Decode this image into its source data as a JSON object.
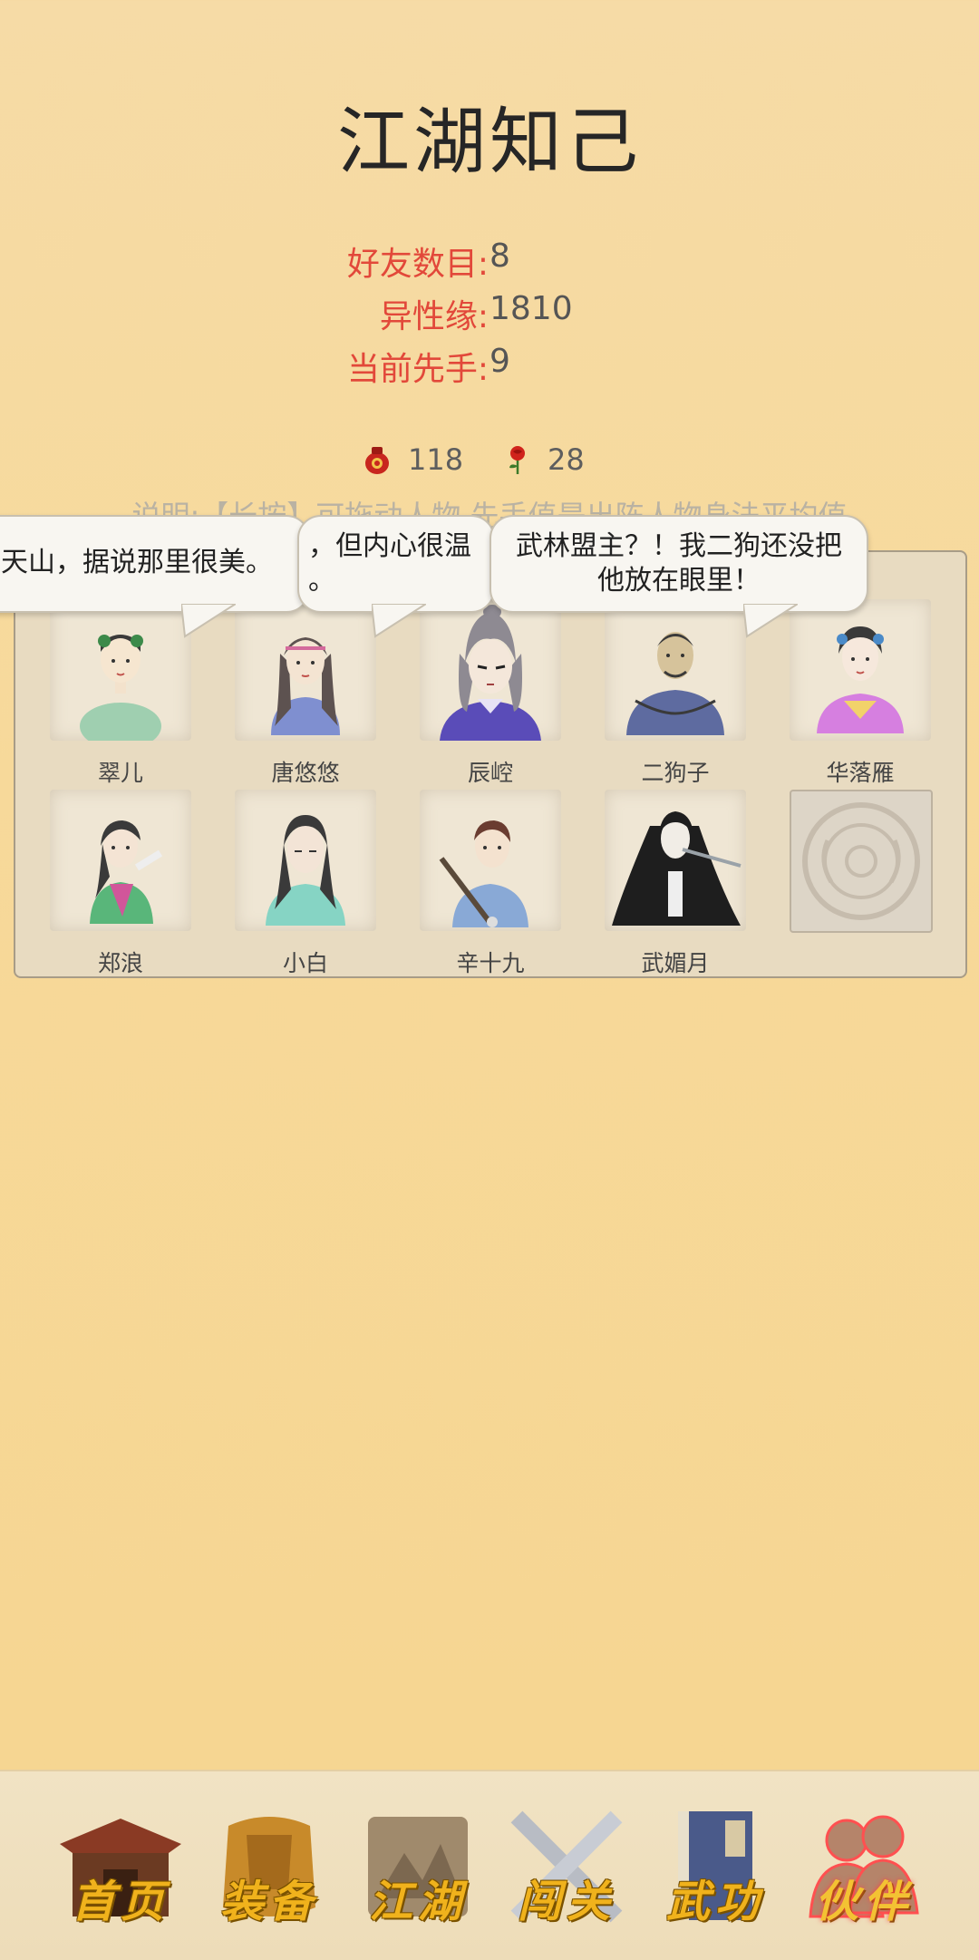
{
  "title": "江湖知己",
  "stats": [
    {
      "label": "好友数目:",
      "value": "8"
    },
    {
      "label": "异性缘:",
      "value": "1810"
    },
    {
      "label": "当前先手:",
      "value": "9"
    }
  ],
  "currency": {
    "wine": {
      "icon": "wine-jar-icon",
      "value": "118"
    },
    "rose": {
      "icon": "rose-icon",
      "value": "28"
    }
  },
  "description": "说明:【长按】可拖动人物,先手值是出阵人物身法平均值",
  "bubbles": [
    {
      "line1": "天山，据说那里很美。",
      "line2": ""
    },
    {
      "line1": "，但内心很温",
      "line2": "。"
    },
    {
      "line1": "武林盟主？！我二狗还没把",
      "line2": "他放在眼里！"
    }
  ],
  "companions": [
    {
      "name": "翠儿",
      "icon": "cuier-portrait"
    },
    {
      "name": "唐悠悠",
      "icon": "tangyouyou-portrait"
    },
    {
      "name": "辰崆",
      "icon": "chenkong-portrait"
    },
    {
      "name": "二狗子",
      "icon": "ergouzi-portrait"
    },
    {
      "name": "华落雁",
      "icon": "hualuoyan-portrait"
    },
    {
      "name": "郑浪",
      "icon": "zhenglang-portrait"
    },
    {
      "name": "小白",
      "icon": "xiaobai-portrait"
    },
    {
      "name": "辛十九",
      "icon": "xinshijiu-portrait"
    },
    {
      "name": "武媚月",
      "icon": "wumeiyue-portrait"
    }
  ],
  "nav": [
    {
      "label": "首页",
      "icon": "temple-icon",
      "active": false
    },
    {
      "label": "装备",
      "icon": "armor-icon",
      "active": false
    },
    {
      "label": "江湖",
      "icon": "scroll-map-icon",
      "active": false
    },
    {
      "label": "闯关",
      "icon": "crossed-swords-icon",
      "active": false
    },
    {
      "label": "武功",
      "icon": "book-icon",
      "active": false
    },
    {
      "label": "伙伴",
      "icon": "companions-icon",
      "active": true
    }
  ]
}
